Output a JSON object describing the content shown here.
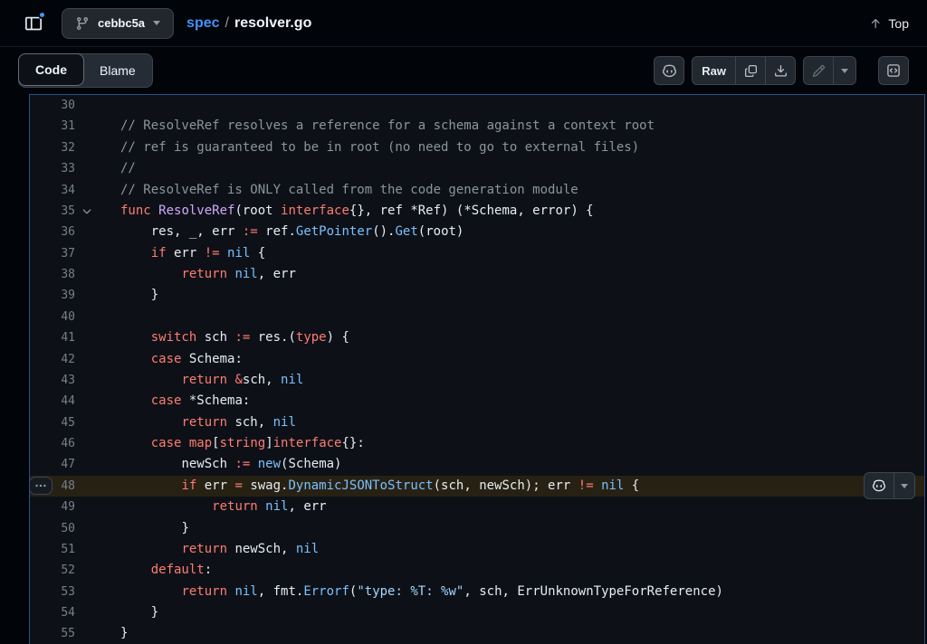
{
  "header": {
    "branch": {
      "label": "cebbc5a"
    },
    "breadcrumb": {
      "dir": "spec",
      "sep": "/",
      "file": "resolver.go"
    },
    "top_button": {
      "label": "Top"
    }
  },
  "toolbar": {
    "tabs": [
      {
        "label": "Code",
        "active": true
      },
      {
        "label": "Blame",
        "active": false
      }
    ],
    "raw_label": "Raw"
  },
  "colors": {
    "accent-blue": "#4493f8",
    "bg-page": "#010409",
    "bg-code": "#0d1117",
    "border-muted": "#3d444d",
    "highlight-line": "rgba(187,128,9,0.15)",
    "syntax-keyword": "#ff7b72",
    "syntax-comment": "#8b949e",
    "syntax-constant": "#79c0ff",
    "syntax-entity": "#d2a8ff",
    "syntax-string": "#a5d6ff",
    "text-default": "#e6edf3",
    "line-number": "#767f89"
  },
  "code": {
    "language": "go",
    "highlight_line": 48,
    "lines": [
      {
        "n": 30,
        "i": 0,
        "t": []
      },
      {
        "n": 31,
        "i": 0,
        "t": [
          [
            "c",
            "// ResolveRef resolves a reference for a schema against a context root"
          ]
        ]
      },
      {
        "n": 32,
        "i": 0,
        "t": [
          [
            "c",
            "// ref is guaranteed to be in root (no need to go to external files)"
          ]
        ]
      },
      {
        "n": 33,
        "i": 0,
        "t": [
          [
            "c",
            "//"
          ]
        ]
      },
      {
        "n": 34,
        "i": 0,
        "t": [
          [
            "c",
            "// ResolveRef is ONLY called from the code generation module"
          ]
        ]
      },
      {
        "n": 35,
        "i": 0,
        "fold": true,
        "t": [
          [
            "k",
            "func"
          ],
          [
            "p",
            " "
          ],
          [
            "f",
            "ResolveRef"
          ],
          [
            "p",
            "(root "
          ],
          [
            "k",
            "interface"
          ],
          [
            "p",
            "{}, ref *Ref) (*Schema, error) {"
          ]
        ]
      },
      {
        "n": 36,
        "i": 1,
        "t": [
          [
            "p",
            "res, _, err "
          ],
          [
            "k",
            ":="
          ],
          [
            "p",
            " ref."
          ],
          [
            "b",
            "GetPointer"
          ],
          [
            "p",
            "()."
          ],
          [
            "b",
            "Get"
          ],
          [
            "p",
            "(root)"
          ]
        ]
      },
      {
        "n": 37,
        "i": 1,
        "t": [
          [
            "k",
            "if"
          ],
          [
            "p",
            " err "
          ],
          [
            "k",
            "!="
          ],
          [
            "p",
            " "
          ],
          [
            "b",
            "nil"
          ],
          [
            "p",
            " {"
          ]
        ]
      },
      {
        "n": 38,
        "i": 2,
        "t": [
          [
            "k",
            "return"
          ],
          [
            "p",
            " "
          ],
          [
            "b",
            "nil"
          ],
          [
            "p",
            ", err"
          ]
        ]
      },
      {
        "n": 39,
        "i": 1,
        "t": [
          [
            "p",
            "}"
          ]
        ]
      },
      {
        "n": 40,
        "i": 0,
        "t": []
      },
      {
        "n": 41,
        "i": 1,
        "t": [
          [
            "k",
            "switch"
          ],
          [
            "p",
            " sch "
          ],
          [
            "k",
            ":="
          ],
          [
            "p",
            " res.("
          ],
          [
            "k",
            "type"
          ],
          [
            "p",
            ") {"
          ]
        ]
      },
      {
        "n": 42,
        "i": 1,
        "t": [
          [
            "k",
            "case"
          ],
          [
            "p",
            " Schema:"
          ]
        ]
      },
      {
        "n": 43,
        "i": 2,
        "t": [
          [
            "k",
            "return"
          ],
          [
            "p",
            " "
          ],
          [
            "k",
            "&"
          ],
          [
            "p",
            "sch, "
          ],
          [
            "b",
            "nil"
          ]
        ]
      },
      {
        "n": 44,
        "i": 1,
        "t": [
          [
            "k",
            "case"
          ],
          [
            "p",
            " *Schema:"
          ]
        ]
      },
      {
        "n": 45,
        "i": 2,
        "t": [
          [
            "k",
            "return"
          ],
          [
            "p",
            " sch, "
          ],
          [
            "b",
            "nil"
          ]
        ]
      },
      {
        "n": 46,
        "i": 1,
        "t": [
          [
            "k",
            "case"
          ],
          [
            "p",
            " "
          ],
          [
            "k",
            "map"
          ],
          [
            "p",
            "["
          ],
          [
            "k",
            "string"
          ],
          [
            "p",
            "]"
          ],
          [
            "k",
            "interface"
          ],
          [
            "p",
            "{}:"
          ]
        ]
      },
      {
        "n": 47,
        "i": 2,
        "t": [
          [
            "p",
            "newSch "
          ],
          [
            "k",
            ":="
          ],
          [
            "p",
            " "
          ],
          [
            "b",
            "new"
          ],
          [
            "p",
            "(Schema)"
          ]
        ]
      },
      {
        "n": 48,
        "i": 2,
        "t": [
          [
            "k",
            "if"
          ],
          [
            "p",
            " err "
          ],
          [
            "k",
            "="
          ],
          [
            "p",
            " swag."
          ],
          [
            "b",
            "DynamicJSONToStruct"
          ],
          [
            "p",
            "(sch, newSch); err "
          ],
          [
            "k",
            "!="
          ],
          [
            "p",
            " "
          ],
          [
            "b",
            "nil"
          ],
          [
            "p",
            " {"
          ]
        ]
      },
      {
        "n": 49,
        "i": 3,
        "t": [
          [
            "k",
            "return"
          ],
          [
            "p",
            " "
          ],
          [
            "b",
            "nil"
          ],
          [
            "p",
            ", err"
          ]
        ]
      },
      {
        "n": 50,
        "i": 2,
        "t": [
          [
            "p",
            "}"
          ]
        ]
      },
      {
        "n": 51,
        "i": 2,
        "t": [
          [
            "k",
            "return"
          ],
          [
            "p",
            " newSch, "
          ],
          [
            "b",
            "nil"
          ]
        ]
      },
      {
        "n": 52,
        "i": 1,
        "t": [
          [
            "k",
            "default"
          ],
          [
            "p",
            ":"
          ]
        ]
      },
      {
        "n": 53,
        "i": 2,
        "t": [
          [
            "k",
            "return"
          ],
          [
            "p",
            " "
          ],
          [
            "b",
            "nil"
          ],
          [
            "p",
            ", fmt."
          ],
          [
            "b",
            "Errorf"
          ],
          [
            "p",
            "("
          ],
          [
            "s",
            "\"type: %T: %w\""
          ],
          [
            "p",
            ", sch, ErrUnknownTypeForReference)"
          ]
        ]
      },
      {
        "n": 54,
        "i": 1,
        "t": [
          [
            "p",
            "}"
          ]
        ]
      },
      {
        "n": 55,
        "i": 0,
        "t": [
          [
            "p",
            "}"
          ]
        ]
      }
    ]
  }
}
